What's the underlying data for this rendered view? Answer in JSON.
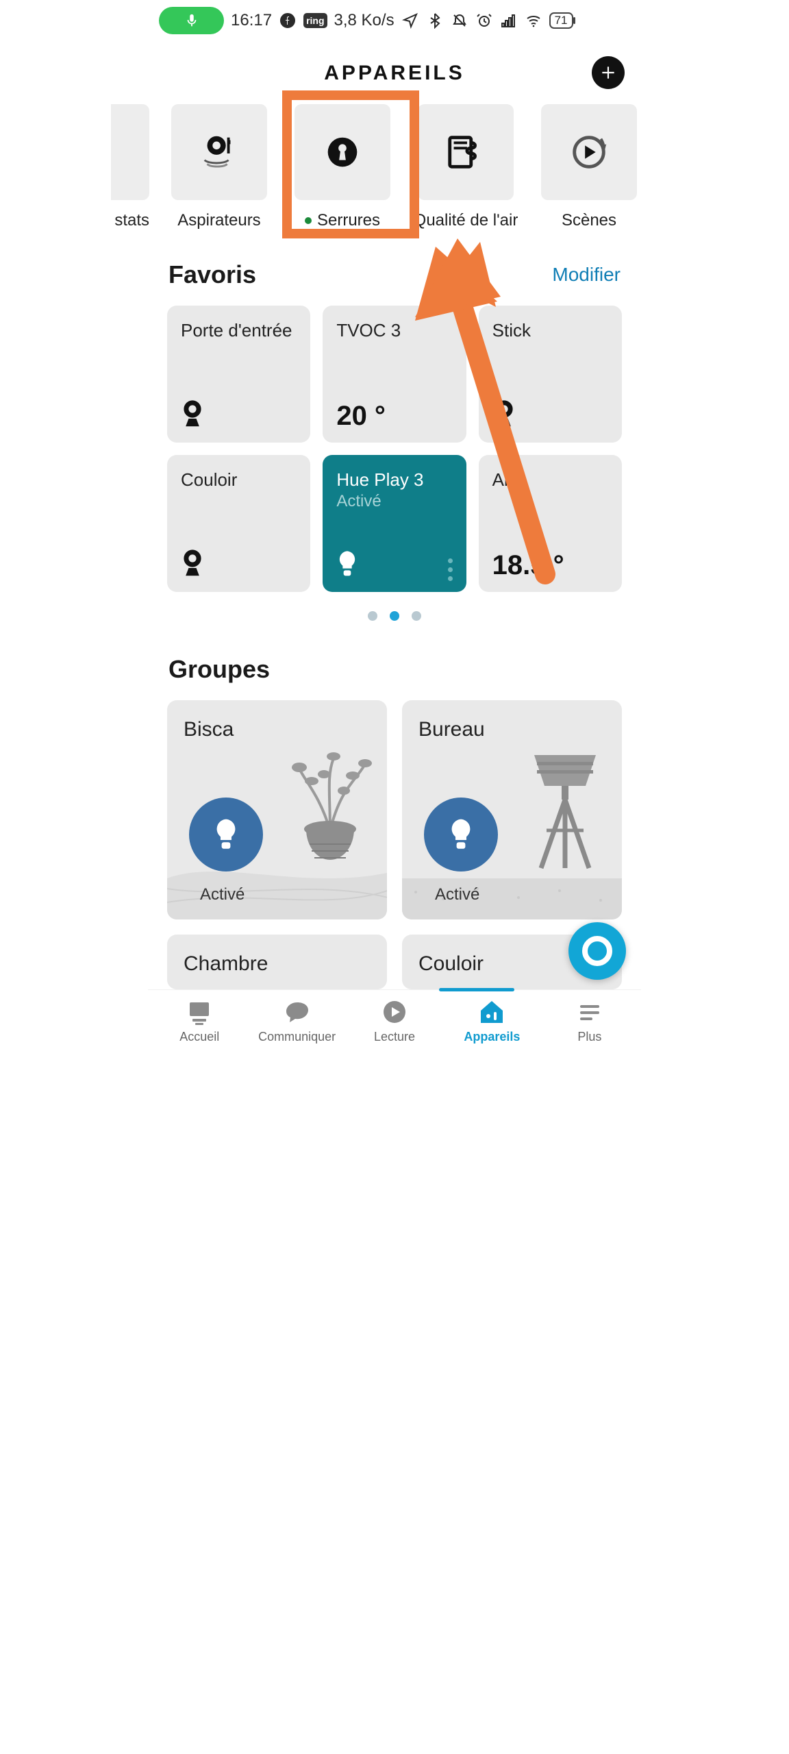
{
  "status_bar": {
    "time": "16:17",
    "data_rate": "3,8 Ko/s",
    "ring_badge": "ring",
    "battery_level": "71"
  },
  "header": {
    "title": "APPAREILS"
  },
  "categories": {
    "items": [
      {
        "label": "stats"
      },
      {
        "label": "Aspirateurs"
      },
      {
        "label": "Serrures",
        "has_status_dot": true
      },
      {
        "label": "Qualité de l'air"
      },
      {
        "label": "Scènes"
      }
    ]
  },
  "favorites": {
    "heading": "Favoris",
    "edit_label": "Modifier",
    "cards": [
      {
        "name": "Porte d'entrée",
        "icon": "camera"
      },
      {
        "name": "TVOC 3",
        "value": "20 °"
      },
      {
        "name": "Stick",
        "icon": "camera_hidden"
      },
      {
        "name": "Couloir",
        "icon": "camera"
      },
      {
        "name": "Hue Play 3",
        "sub": "Activé",
        "active": true,
        "icon": "bulb"
      },
      {
        "name": "Air",
        "value": "18.5 °"
      }
    ],
    "page_index": 1,
    "page_count": 3
  },
  "groups": {
    "heading": "Groupes",
    "cards": [
      {
        "name": "Bisca",
        "state": "Activé",
        "illus": "plant"
      },
      {
        "name": "Bureau",
        "state": "Activé",
        "illus": "lamp"
      },
      {
        "name": "Chambre"
      },
      {
        "name": "Couloir"
      }
    ]
  },
  "bottom_nav": {
    "items": [
      {
        "label": "Accueil"
      },
      {
        "label": "Communiquer"
      },
      {
        "label": "Lecture"
      },
      {
        "label": "Appareils",
        "active": true
      },
      {
        "label": "Plus"
      }
    ]
  }
}
